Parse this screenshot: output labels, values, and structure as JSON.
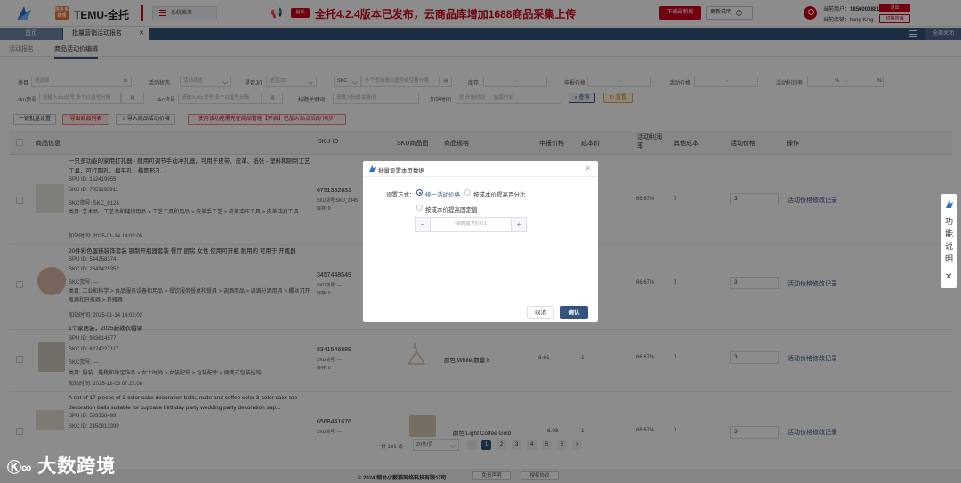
{
  "header": {
    "temu_badge": "拼多多跨境",
    "app_title": "TEMU-全托",
    "system_menu": "系统菜单",
    "new_badge": "最新",
    "announcement": "全托4.2.4版本已发布，云商品库增加1688商品采集上传",
    "download_btn": "下载最新版",
    "update_btn": "更新说明",
    "user_label": "当前用户：",
    "user_phone": "18560008818",
    "logout_btn": "退出",
    "shop_label": "当前店铺：",
    "shop_name": "liang King",
    "switch_btn": "切换店铺"
  },
  "nav": {
    "tab_home": "首页",
    "tab_batch": "批量营销活动报名",
    "close_all": "全部关闭"
  },
  "subtabs": [
    "活动报名",
    "商品活动价编辑"
  ],
  "filters": {
    "category_label": "类目",
    "category_ph": "请选择",
    "activity_status_label": "活动状态",
    "activity_status_ph": "活动状态",
    "site_label": "是否JIT",
    "site_ph": "是否JIT",
    "skc_label": "SKC",
    "skc_ph": "多个查询请以逗号或空格分隔",
    "stock_label": "库存",
    "declared_price_label": "申报价格",
    "activity_price_label": "活动价格",
    "profit_rate_label": "活动利润率",
    "pct": "%",
    "sku_no_label": "sku货号",
    "sku_no_ph": "请输入sku货号,多个以逗号分隔",
    "skcno_label": "skc货号",
    "skcno_ph": "请输入skc货号,多个以逗号分隔",
    "title_kw_label": "标题关键词",
    "title_kw_ph": "请输入标题关键词",
    "add_time_label": "加站时间",
    "start_ph": "开始时间",
    "end_ph": "结束时间",
    "query_btn": "查询",
    "reset_btn": "重置"
  },
  "actions": {
    "batch_set": "一键批量设置",
    "export": "导出商品列表",
    "import": "导入商品活动价格",
    "notice": "使用该功能需先在商品管理【开启】已加入站点后的\"同步\""
  },
  "table": {
    "headers": [
      "商品信息",
      "SKU ID",
      "SKU商品图",
      "商品规格",
      "申报价格",
      "成本价",
      "活动利润率",
      "其他成本",
      "活动价格",
      "操作"
    ],
    "rows": [
      {
        "title": "一只多功能的家用打孔器 - 耐用可调节手动冲孔器，可用于皮带、皮革、纸张 - 塑料和铜制工艺工具，可打圆孔、扁平孔、椭圆形孔",
        "spu": "SPU ID:  162419955",
        "skc": "SKC ID:  7351193911",
        "skcno": "SKC货号:  SKC_0123",
        "category": "类目:  艺术品、工艺品和缝纫用品 > 工艺工具和用品 > 皮革手工艺 > 皮革冲压工具 > 皮革冲孔工具",
        "add_time": "加站时间:  2025-01-14 14:02:05",
        "sku_id": "6791382631",
        "sku_sub1": "SKU货号:SKU_2345",
        "sku_sub2": "库存:  0",
        "spec": "",
        "declared": "",
        "cost": "",
        "rate": "66.67%",
        "other": "0",
        "price": "3",
        "op": "活动价格修改记录"
      },
      {
        "title": "20件彩色蛋糕装饰套装 钢制开瓶器套装 餐厅 厨房 女性 使用可开瓶 耐用的 可用于 开瓶器",
        "spu": "SPU ID:  544258374",
        "skc": "SKC ID:  2649425352",
        "skcno": "SKC货号:  ---",
        "category": "类目:  工业和科学 > 食品服务设备和用品 > 餐饮服务餐桌和餐具 > 调酒用品 > 调酒分酒用具 > 螺丝刀开瓶器和开瓶器 > 开瓶器",
        "add_time": "加站时间:  2025-01-14 14:02:02",
        "sku_id": "3457448549",
        "sku_sub1": "SKU货号:  ---",
        "sku_sub2": "库存:  0",
        "spec": "",
        "declared": "",
        "cost": "",
        "rate": "66.67%",
        "other": "0",
        "price": "3",
        "op": "活动价格修改记录"
      },
      {
        "title": "1个家居装，2025新款衣帽架",
        "spu": "SPU ID:  933614577",
        "skc": "SKC ID:  6274227117",
        "skcno": "SKC货号:  ---",
        "category": "类目:  服装、鞋靴和珠宝饰品 > 女士时尚 > 女装配饰 > 包装配件 > 便携式包装挂钩",
        "add_time": "加站时间:  2025-12-03 07:22:08",
        "sku_id": "8341546889",
        "sku_sub1": "SKU货号:  ---",
        "sku_sub2": "库存:  0",
        "spec": "颜色:White,数量:8",
        "declared": "8.91",
        "cost": "1",
        "rate": "66.67%",
        "other": "0",
        "price": "3",
        "op": "活动价格修改记录"
      },
      {
        "title": "A set of 17 pieces of 3-color cake decoration balls, nude and coffee color 3-color cake top decoration balls suitable for cupcake birthday party wedding party decoration sup...",
        "spu": "SPU ID:  593338499",
        "skc": "SKC ID:  2450813399",
        "skcno": "",
        "category": "",
        "add_time": "",
        "sku_id": "6568441676",
        "sku_sub1": "SKU货号:  ---",
        "sku_sub2": "",
        "spec": "颜色:Light Coffee Gold",
        "declared": "6.98",
        "cost": "1",
        "rate": "66.67%",
        "other": "0",
        "price": "3",
        "op": "活动价格修改记录"
      }
    ]
  },
  "pagination": {
    "total": "共 101 条",
    "page_size": "20条/页",
    "pages": [
      "1",
      "2",
      "3",
      "4",
      "5",
      "6"
    ],
    "prev": "<",
    "next": ">"
  },
  "modal": {
    "title": "批量设置本页数据",
    "mode_label": "设置方式：",
    "opt1": "统一活动价格",
    "opt2": "按成本价提高百分比",
    "opt3": "按成本价提高固定值",
    "stepper_ph": "精确度为0.01",
    "minus": "−",
    "plus": "+",
    "cancel": "取消",
    "confirm": "确认"
  },
  "side_help": {
    "text": "功能说明",
    "close": "✕"
  },
  "footer": {
    "copyright": "© 2024 烟台小薮猫网络科技有限公司",
    "disclaimer": "免责声明",
    "license": "授权协议"
  },
  "watermark": "大数跨境",
  "colors": {
    "brand_red": "#d0021b",
    "nav_blue": "#34547d",
    "link_blue": "#2a4f85",
    "temu_orange": "#f37021"
  }
}
